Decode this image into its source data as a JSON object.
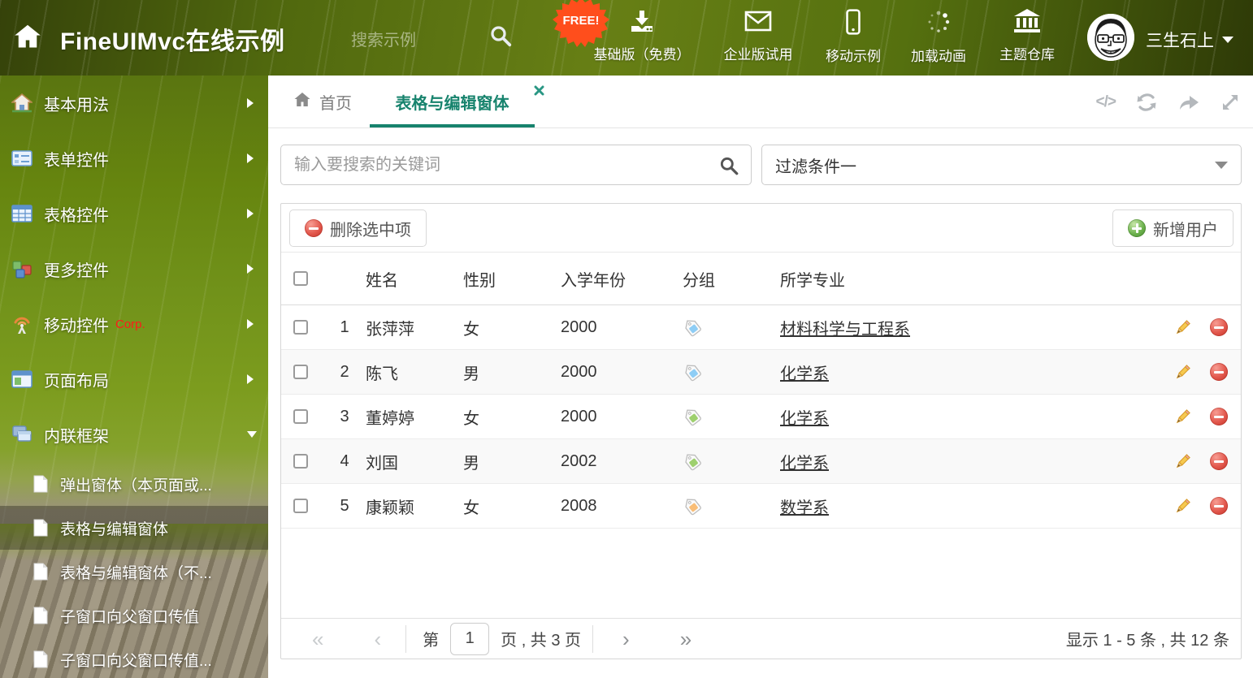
{
  "header": {
    "title": "FineUIMvc在线示例",
    "search_placeholder": "搜索示例",
    "free_badge": "FREE!",
    "nav": [
      {
        "label": "基础版（免费）",
        "icon": "download-icon"
      },
      {
        "label": "企业版试用",
        "icon": "envelope-icon"
      },
      {
        "label": "移动示例",
        "icon": "mobile-icon"
      },
      {
        "label": "加载动画",
        "icon": "spinner-icon"
      },
      {
        "label": "主题仓库",
        "icon": "bank-icon"
      }
    ],
    "user_name": "三生石上"
  },
  "sidebar": {
    "items": [
      {
        "label": "基本用法",
        "icon": "home-icon"
      },
      {
        "label": "表单控件",
        "icon": "form-icon"
      },
      {
        "label": "表格控件",
        "icon": "table-icon"
      },
      {
        "label": "更多控件",
        "icon": "cubes-icon"
      },
      {
        "label": "移动控件",
        "icon": "antenna-icon",
        "badge": "Corp."
      },
      {
        "label": "页面布局",
        "icon": "layout-icon"
      },
      {
        "label": "内联框架",
        "icon": "frames-icon"
      }
    ],
    "subitems": [
      "弹出窗体（本页面或...",
      "表格与编辑窗体",
      "表格与编辑窗体（不...",
      "子窗口向父窗口传值",
      "子窗口向父窗口传值..."
    ]
  },
  "tabs": {
    "home_label": "首页",
    "active_label": "表格与编辑窗体"
  },
  "icons": {
    "code_glyph": "</>",
    "prev_all": "«",
    "prev": "‹",
    "next": "›",
    "next_all": "»"
  },
  "filters": {
    "search_placeholder": "输入要搜索的关键词",
    "filter_value": "过滤条件一"
  },
  "toolbar": {
    "delete_label": "删除选中项",
    "add_label": "新增用户"
  },
  "table": {
    "columns": {
      "name": "姓名",
      "gender": "性别",
      "year": "入学年份",
      "group": "分组",
      "major": "所学专业"
    },
    "rows": [
      {
        "index": "1",
        "name": "张萍萍",
        "gender": "女",
        "year": "2000",
        "tag_color": "#8ecdf5",
        "major": "材料科学与工程系"
      },
      {
        "index": "2",
        "name": "陈飞",
        "gender": "男",
        "year": "2000",
        "tag_color": "#8ecdf5",
        "major": "化学系"
      },
      {
        "index": "3",
        "name": "董婷婷",
        "gender": "女",
        "year": "2000",
        "tag_color": "#9ed06e",
        "major": "化学系"
      },
      {
        "index": "4",
        "name": "刘国",
        "gender": "男",
        "year": "2002",
        "tag_color": "#9ed06e",
        "major": "化学系"
      },
      {
        "index": "5",
        "name": "康颖颖",
        "gender": "女",
        "year": "2008",
        "tag_color": "#f9bd76",
        "major": "数学系"
      }
    ]
  },
  "pagination": {
    "page_prefix": "第",
    "current_page": "1",
    "page_suffix": "页 , 共 3 页",
    "summary": "显示 1 - 5 条 , 共 12 条"
  }
}
